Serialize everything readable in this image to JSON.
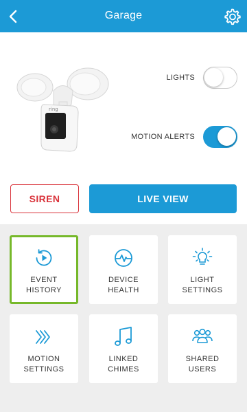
{
  "header": {
    "title": "Garage"
  },
  "toggles": {
    "lights": {
      "label": "LIGHTS",
      "on": false
    },
    "motion_alerts": {
      "label": "MOTION ALERTS",
      "on": true
    }
  },
  "actions": {
    "siren": "SIREN",
    "live_view": "LIVE VIEW"
  },
  "device_logo": "ring",
  "tiles": [
    {
      "line1": "EVENT",
      "line2": "HISTORY",
      "icon": "event-history-icon",
      "selected": true
    },
    {
      "line1": "DEVICE",
      "line2": "HEALTH",
      "icon": "device-health-icon",
      "selected": false
    },
    {
      "line1": "LIGHT",
      "line2": "SETTINGS",
      "icon": "light-settings-icon",
      "selected": false
    },
    {
      "line1": "MOTION",
      "line2": "SETTINGS",
      "icon": "motion-settings-icon",
      "selected": false
    },
    {
      "line1": "LINKED",
      "line2": "CHIMES",
      "icon": "linked-chimes-icon",
      "selected": false
    },
    {
      "line1": "SHARED",
      "line2": "USERS",
      "icon": "shared-users-icon",
      "selected": false
    }
  ],
  "colors": {
    "accent": "#1c9ad6",
    "siren": "#d9323a",
    "selected_border": "#76b82a",
    "grid_bg": "#eeeeee"
  }
}
